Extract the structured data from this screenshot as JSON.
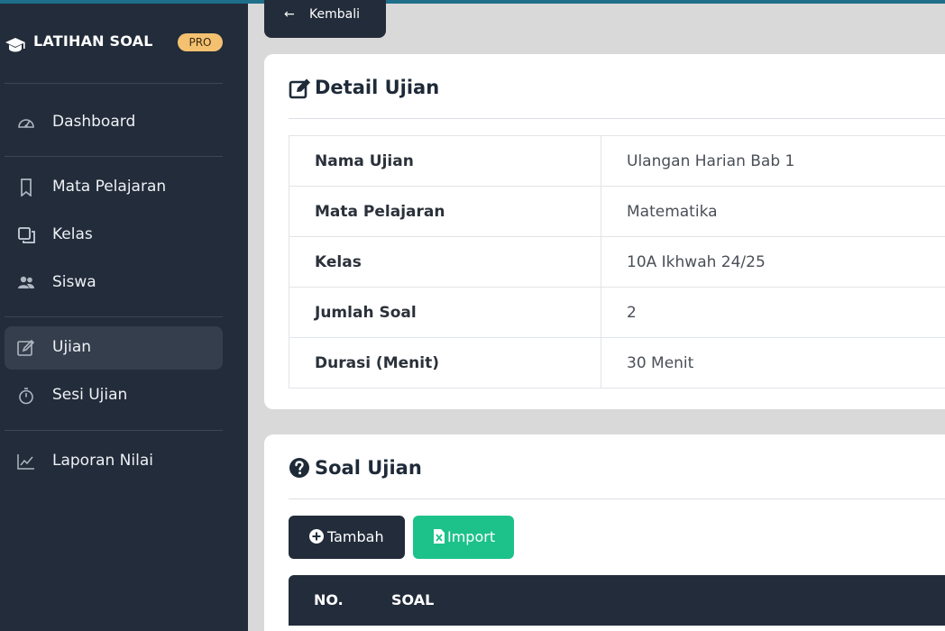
{
  "sidebar": {
    "brand": "LATIHAN SOAL",
    "badge": "PRO",
    "items": [
      {
        "label": "Dashboard",
        "icon": "gauge-icon"
      },
      {
        "label": "Mata Pelajaran",
        "icon": "bookmark-icon"
      },
      {
        "label": "Kelas",
        "icon": "copy-icon"
      },
      {
        "label": "Siswa",
        "icon": "users-icon"
      },
      {
        "label": "Ujian",
        "icon": "edit-icon",
        "active": true
      },
      {
        "label": "Sesi Ujian",
        "icon": "stopwatch-icon"
      },
      {
        "label": "Laporan Nilai",
        "icon": "chart-line-icon"
      }
    ]
  },
  "back_button": {
    "arrow": "←",
    "label": "Kembali"
  },
  "detail": {
    "title": "Detail Ujian",
    "rows": [
      {
        "key": "Nama Ujian",
        "value": "Ulangan Harian Bab 1"
      },
      {
        "key": "Mata Pelajaran",
        "value": "Matematika"
      },
      {
        "key": "Kelas",
        "value": "10A Ikhwah 24/25"
      },
      {
        "key": "Jumlah Soal",
        "value": "2"
      },
      {
        "key": "Durasi (Menit)",
        "value": "30 Menit"
      }
    ]
  },
  "soal": {
    "title": "Soal Ujian",
    "add_label": "Tambah",
    "import_label": "Import",
    "columns": [
      "NO.",
      "SOAL"
    ]
  },
  "colors": {
    "sidebar_bg": "#222c3a",
    "badge_bg": "#f4c171",
    "import_bg": "#1cc289",
    "page_bg": "#d9d9d9"
  }
}
